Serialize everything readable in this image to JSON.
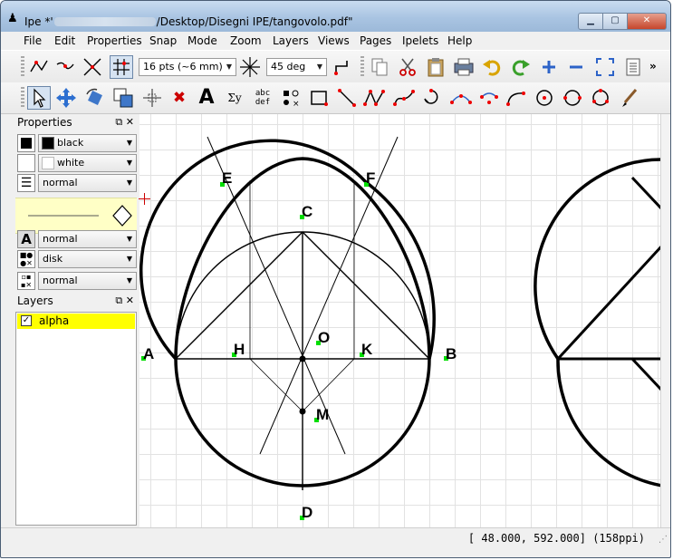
{
  "window": {
    "title_prefix": "Ipe *'",
    "title_suffix": "/Desktop/Disegni IPE/tangovolo.pdf\"",
    "app_icon": "ipe-logo-icon",
    "buttons": {
      "minimize": "minimize-icon",
      "maximize": "maximize-icon",
      "close": "close-icon"
    }
  },
  "menubar": [
    "File",
    "Edit",
    "Properties",
    "Snap",
    "Mode",
    "Zoom",
    "Layers",
    "Views",
    "Pages",
    "Ipelets",
    "Help"
  ],
  "toolbar1": {
    "grid_size": "16 pts (~6 mm)",
    "angle": "45 deg",
    "more": "»"
  },
  "properties_panel": {
    "title": "Properties",
    "stroke": "black",
    "fill": "white",
    "pen": "normal",
    "textsize": "normal",
    "mark_shape": "disk",
    "symbol_size": "normal"
  },
  "layers_panel": {
    "title": "Layers",
    "layers": [
      {
        "name": "alpha",
        "visible": true
      }
    ]
  },
  "status": {
    "coords": "[ 48.000, 592.000]",
    "resolution": "(158ppi)"
  },
  "drawing": {
    "labels": [
      "E",
      "F",
      "C",
      "A",
      "H",
      "O",
      "K",
      "B",
      "M",
      "D"
    ]
  },
  "colors": {
    "accent_selection": "#d6e3f2",
    "layer_highlight": "#ffff00",
    "preview_bg": "#ffffc6",
    "mark_color": "#00dd00",
    "cursor_color": "#cc0000"
  }
}
